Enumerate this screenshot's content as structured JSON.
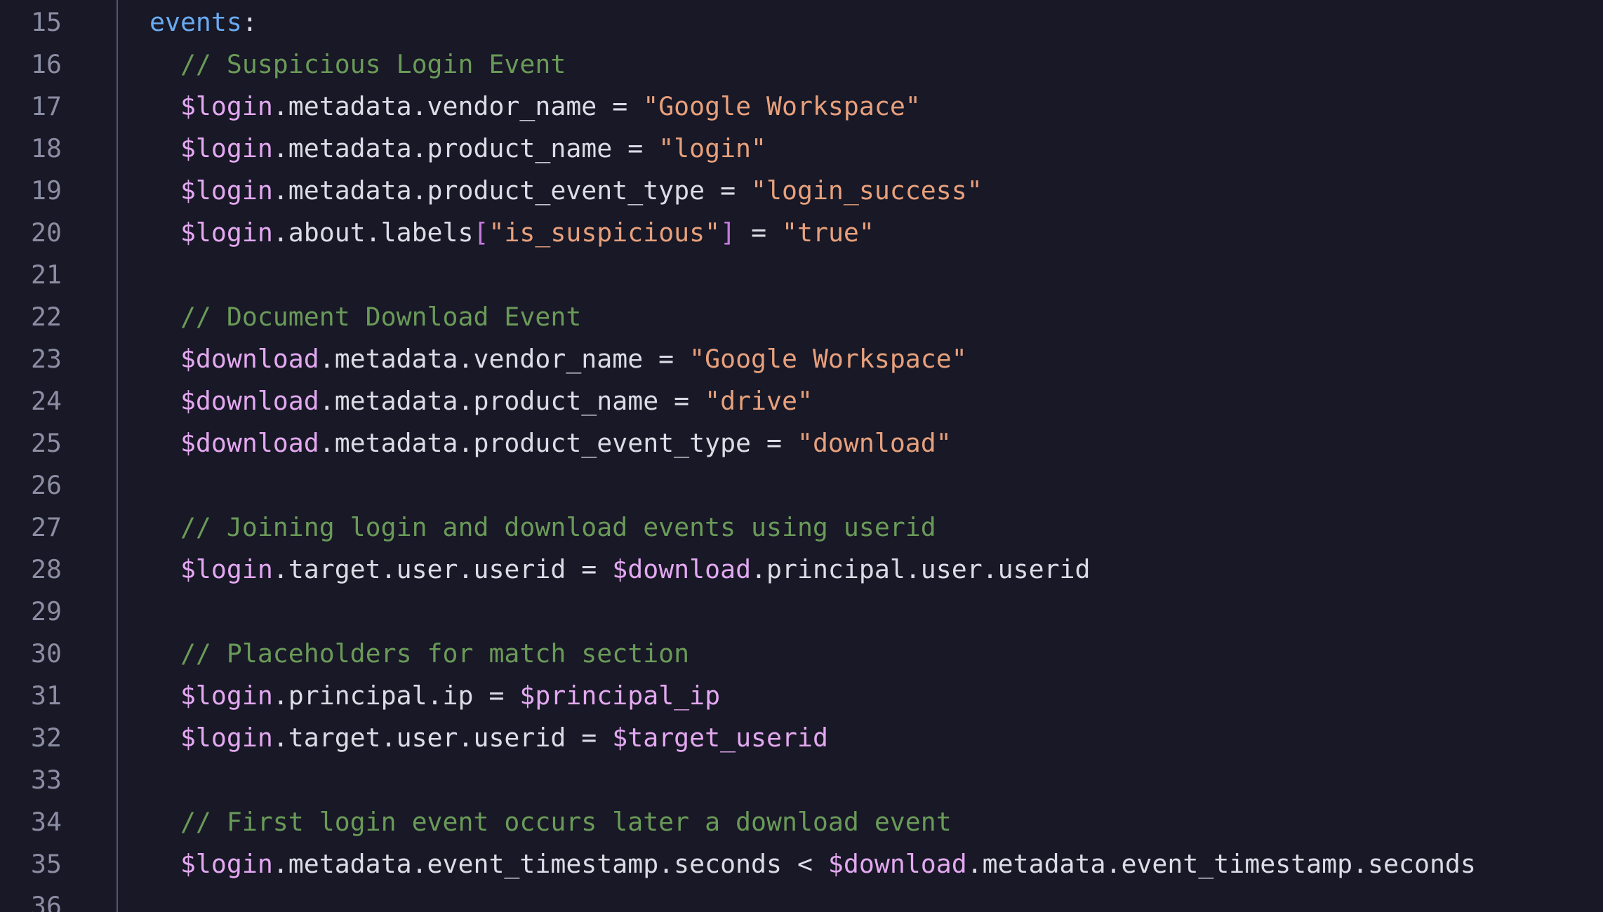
{
  "colors": {
    "background": "#181826",
    "gutter_border": "#55566a",
    "line_number": "#8b8da3",
    "plain": "#dcdce6",
    "variable": "#e3a8f0",
    "string": "#e7a07c",
    "comment": "#6a9a58",
    "keyword": "#6aaaf0",
    "bracket": "#c678dd"
  },
  "editor": {
    "lines": [
      {
        "number": "15",
        "tokens": [
          {
            "t": "kw",
            "text": "events"
          },
          {
            "t": "plain",
            "text": ":"
          }
        ]
      },
      {
        "number": "16",
        "tokens": [
          {
            "t": "com",
            "text": "  // Suspicious Login Event"
          }
        ]
      },
      {
        "number": "17",
        "tokens": [
          {
            "t": "plain",
            "text": "  "
          },
          {
            "t": "var",
            "text": "$login"
          },
          {
            "t": "plain",
            "text": ".metadata.vendor_name = "
          },
          {
            "t": "str",
            "text": "\"Google Workspace\""
          }
        ]
      },
      {
        "number": "18",
        "tokens": [
          {
            "t": "plain",
            "text": "  "
          },
          {
            "t": "var",
            "text": "$login"
          },
          {
            "t": "plain",
            "text": ".metadata.product_name = "
          },
          {
            "t": "str",
            "text": "\"login\""
          }
        ]
      },
      {
        "number": "19",
        "tokens": [
          {
            "t": "plain",
            "text": "  "
          },
          {
            "t": "var",
            "text": "$login"
          },
          {
            "t": "plain",
            "text": ".metadata.product_event_type = "
          },
          {
            "t": "str",
            "text": "\"login_success\""
          }
        ]
      },
      {
        "number": "20",
        "tokens": [
          {
            "t": "plain",
            "text": "  "
          },
          {
            "t": "var",
            "text": "$login"
          },
          {
            "t": "plain",
            "text": ".about.labels"
          },
          {
            "t": "brk",
            "text": "["
          },
          {
            "t": "str",
            "text": "\"is_suspicious\""
          },
          {
            "t": "brk",
            "text": "]"
          },
          {
            "t": "plain",
            "text": " = "
          },
          {
            "t": "str",
            "text": "\"true\""
          }
        ]
      },
      {
        "number": "21",
        "tokens": []
      },
      {
        "number": "22",
        "tokens": [
          {
            "t": "com",
            "text": "  // Document Download Event"
          }
        ]
      },
      {
        "number": "23",
        "tokens": [
          {
            "t": "plain",
            "text": "  "
          },
          {
            "t": "var",
            "text": "$download"
          },
          {
            "t": "plain",
            "text": ".metadata.vendor_name = "
          },
          {
            "t": "str",
            "text": "\"Google Workspace\""
          }
        ]
      },
      {
        "number": "24",
        "tokens": [
          {
            "t": "plain",
            "text": "  "
          },
          {
            "t": "var",
            "text": "$download"
          },
          {
            "t": "plain",
            "text": ".metadata.product_name = "
          },
          {
            "t": "str",
            "text": "\"drive\""
          }
        ]
      },
      {
        "number": "25",
        "tokens": [
          {
            "t": "plain",
            "text": "  "
          },
          {
            "t": "var",
            "text": "$download"
          },
          {
            "t": "plain",
            "text": ".metadata.product_event_type = "
          },
          {
            "t": "str",
            "text": "\"download\""
          }
        ]
      },
      {
        "number": "26",
        "tokens": []
      },
      {
        "number": "27",
        "tokens": [
          {
            "t": "com",
            "text": "  // Joining login and download events using userid"
          }
        ]
      },
      {
        "number": "28",
        "tokens": [
          {
            "t": "plain",
            "text": "  "
          },
          {
            "t": "var",
            "text": "$login"
          },
          {
            "t": "plain",
            "text": ".target.user.userid = "
          },
          {
            "t": "var",
            "text": "$download"
          },
          {
            "t": "plain",
            "text": ".principal.user.userid"
          }
        ]
      },
      {
        "number": "29",
        "tokens": []
      },
      {
        "number": "30",
        "tokens": [
          {
            "t": "com",
            "text": "  // Placeholders for match section"
          }
        ]
      },
      {
        "number": "31",
        "tokens": [
          {
            "t": "plain",
            "text": "  "
          },
          {
            "t": "var",
            "text": "$login"
          },
          {
            "t": "plain",
            "text": ".principal.ip = "
          },
          {
            "t": "var",
            "text": "$principal_ip"
          }
        ]
      },
      {
        "number": "32",
        "tokens": [
          {
            "t": "plain",
            "text": "  "
          },
          {
            "t": "var",
            "text": "$login"
          },
          {
            "t": "plain",
            "text": ".target.user.userid = "
          },
          {
            "t": "var",
            "text": "$target_userid"
          }
        ]
      },
      {
        "number": "33",
        "tokens": []
      },
      {
        "number": "34",
        "tokens": [
          {
            "t": "com",
            "text": "  // First login event occurs later a download event"
          }
        ]
      },
      {
        "number": "35",
        "tokens": [
          {
            "t": "plain",
            "text": "  "
          },
          {
            "t": "var",
            "text": "$login"
          },
          {
            "t": "plain",
            "text": ".metadata.event_timestamp.seconds < "
          },
          {
            "t": "var",
            "text": "$download"
          },
          {
            "t": "plain",
            "text": ".metadata.event_timestamp.seconds"
          }
        ]
      },
      {
        "number": "36",
        "tokens": []
      }
    ]
  }
}
